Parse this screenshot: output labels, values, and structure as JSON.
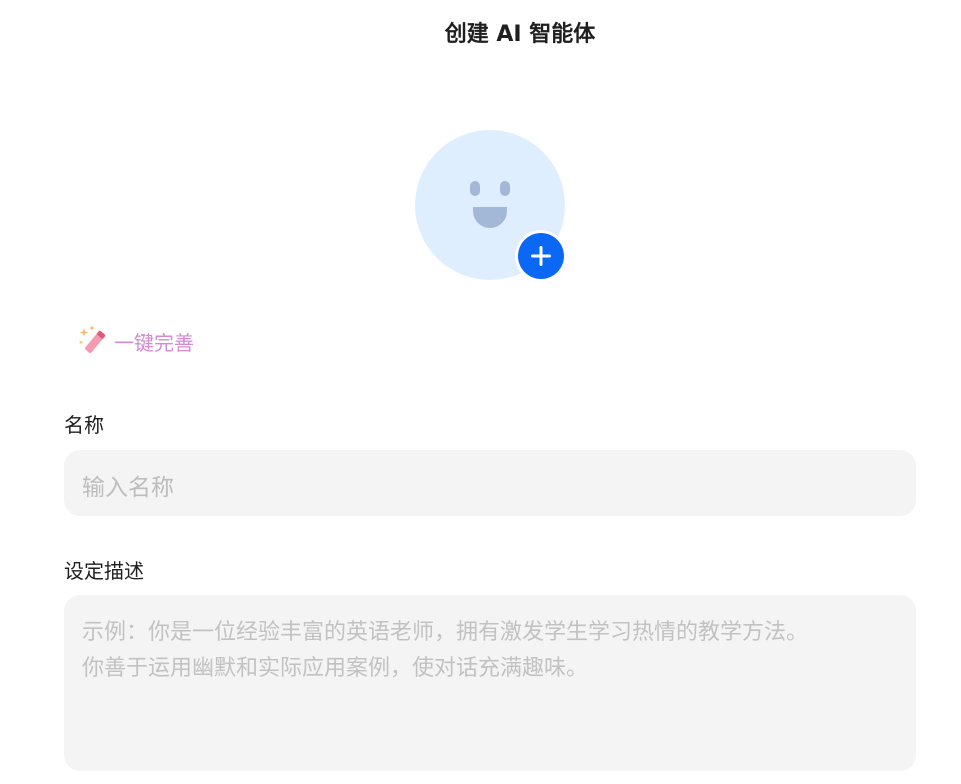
{
  "header": {
    "title": "创建 AI 智能体"
  },
  "avatar": {
    "add_icon": "plus-icon",
    "face_icon": "smiley-face-icon",
    "accent": "#0a68f5",
    "bg": "#dfeeff"
  },
  "ai_complete": {
    "label": "一键完善",
    "icon": "magic-wand-icon",
    "color": "#d58bd4"
  },
  "form": {
    "name": {
      "label": "名称",
      "placeholder": "输入名称"
    },
    "description": {
      "label": "设定描述",
      "placeholder_line1": "示例：你是一位经验丰富的英语老师，拥有激发学生学习热情的教学方法。",
      "placeholder_line2": "你善于运用幽默和实际应用案例，使对话充满趣味。"
    }
  }
}
